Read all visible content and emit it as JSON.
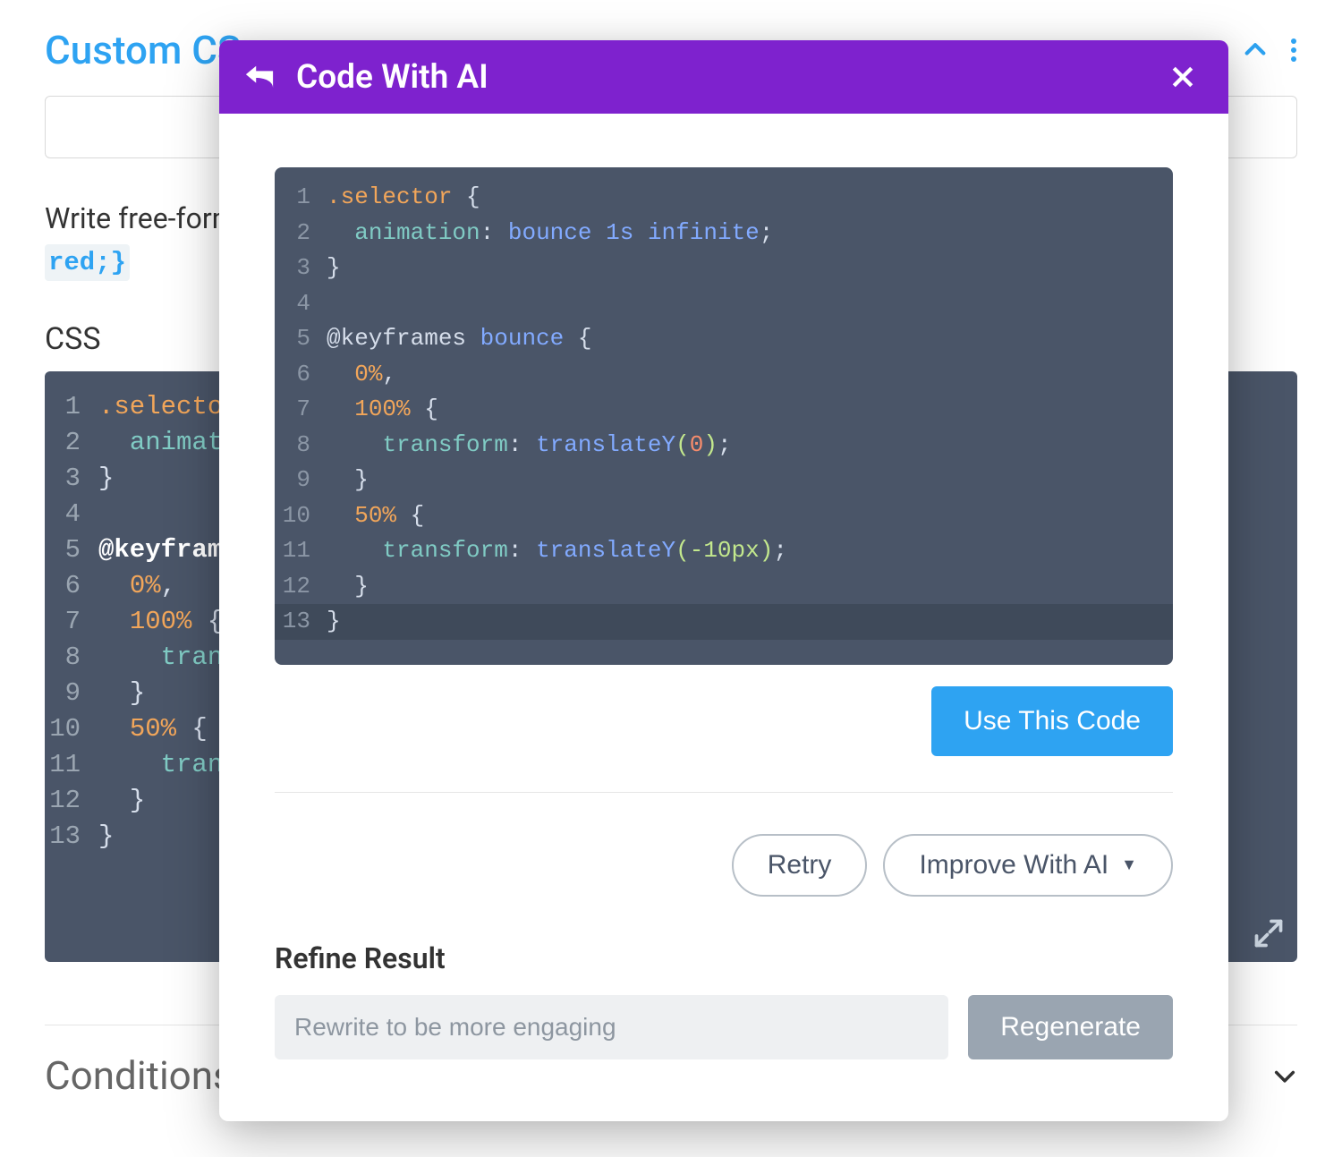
{
  "bg": {
    "section_title": "Custom CS",
    "hint": "Write free-form",
    "snippet": "red;}",
    "css_label": "CSS",
    "code_lines": {
      "l1": ".selecto",
      "l2_prop": "animat",
      "l3": "}",
      "l5_kw": "@keyfram",
      "l6_pct": "0%",
      "l6_comma": ",",
      "l7_pct": "100%",
      "l7_brace": " {",
      "l8_fn": "tran",
      "l9": "}",
      "l10_pct": "50%",
      "l10_brace": " {",
      "l11_fn": "tran",
      "l12": "}",
      "l13": "}"
    },
    "conditions_title": "Conditions"
  },
  "modal": {
    "title": "Code With AI",
    "use_code_label": "Use This Code",
    "retry_label": "Retry",
    "improve_label": "Improve With AI",
    "refine_title": "Refine Result",
    "refine_placeholder": "Rewrite to be more engaging",
    "regenerate_label": "Regenerate",
    "code": {
      "l1_sel": ".selector",
      "l1_brace": " {",
      "l2_prop": "animation",
      "l2_colon": ": ",
      "l2_v1": "bounce",
      "l2_sp1": " ",
      "l2_v2": "1s",
      "l2_sp2": " ",
      "l2_v3": "infinite",
      "l2_semi": ";",
      "l3": "}",
      "l5_kw": "@keyframes",
      "l5_sp": " ",
      "l5_name": "bounce",
      "l5_brace": " {",
      "l6_pct": "0%",
      "l6_comma": ",",
      "l7_pct": "100%",
      "l7_brace": " {",
      "l8_prop": "transform",
      "l8_colon": ": ",
      "l8_fn": "translateY",
      "l8_open": "(",
      "l8_arg": "0",
      "l8_close": ")",
      "l8_semi": ";",
      "l9": "}",
      "l10_pct": "50%",
      "l10_brace": " {",
      "l11_prop": "transform",
      "l11_colon": ": ",
      "l11_fn": "translateY",
      "l11_open": "(",
      "l11_arg": "-10px",
      "l11_close": ")",
      "l11_semi": ";",
      "l12": "}",
      "l13": "}"
    }
  }
}
